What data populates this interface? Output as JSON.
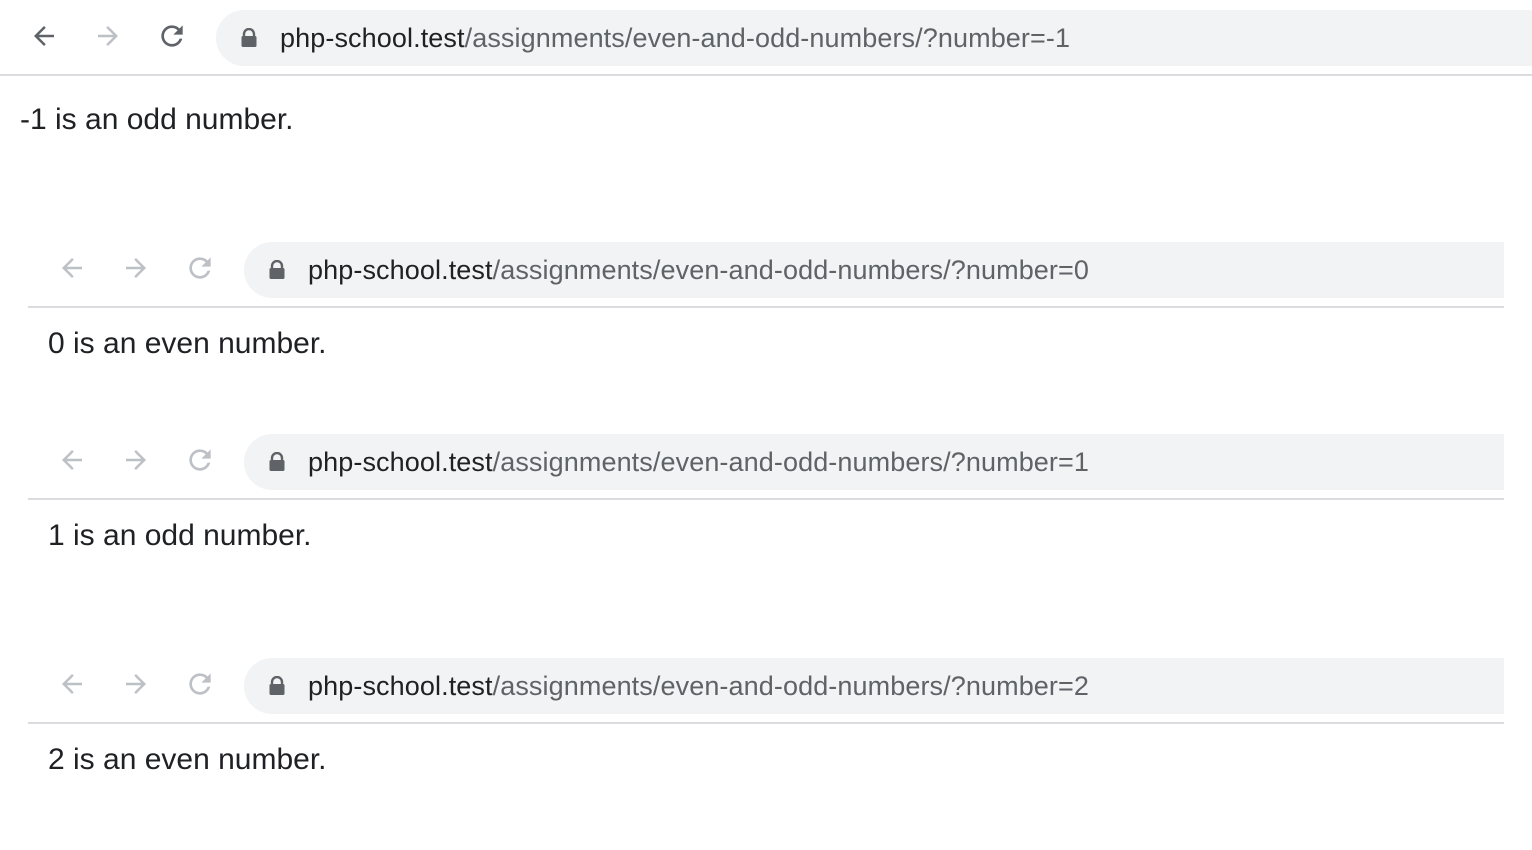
{
  "screenshots": [
    {
      "url_host": "php-school.test",
      "url_path": "/assignments/even-and-odd-numbers/?number=-1",
      "message": "-1 is an odd number.",
      "nav_state": "active"
    },
    {
      "url_host": "php-school.test",
      "url_path": "/assignments/even-and-odd-numbers/?number=0",
      "message": "0 is an even number.",
      "nav_state": "dimmed"
    },
    {
      "url_host": "php-school.test",
      "url_path": "/assignments/even-and-odd-numbers/?number=1",
      "message": "1 is an odd number.",
      "nav_state": "dimmed"
    },
    {
      "url_host": "php-school.test",
      "url_path": "/assignments/even-and-odd-numbers/?number=2",
      "message": "2 is an even number.",
      "nav_state": "dimmed"
    }
  ],
  "icons": {
    "back": "arrow-left-icon",
    "forward": "arrow-right-icon",
    "reload": "reload-icon",
    "lock": "lock-icon"
  },
  "colors": {
    "omnibox_bg": "#f1f3f4",
    "host_text": "#202124",
    "path_text": "#5f6368",
    "icon_active": "#5f6368",
    "icon_dimmed": "#bdc1c6",
    "divider": "#dadce0"
  }
}
